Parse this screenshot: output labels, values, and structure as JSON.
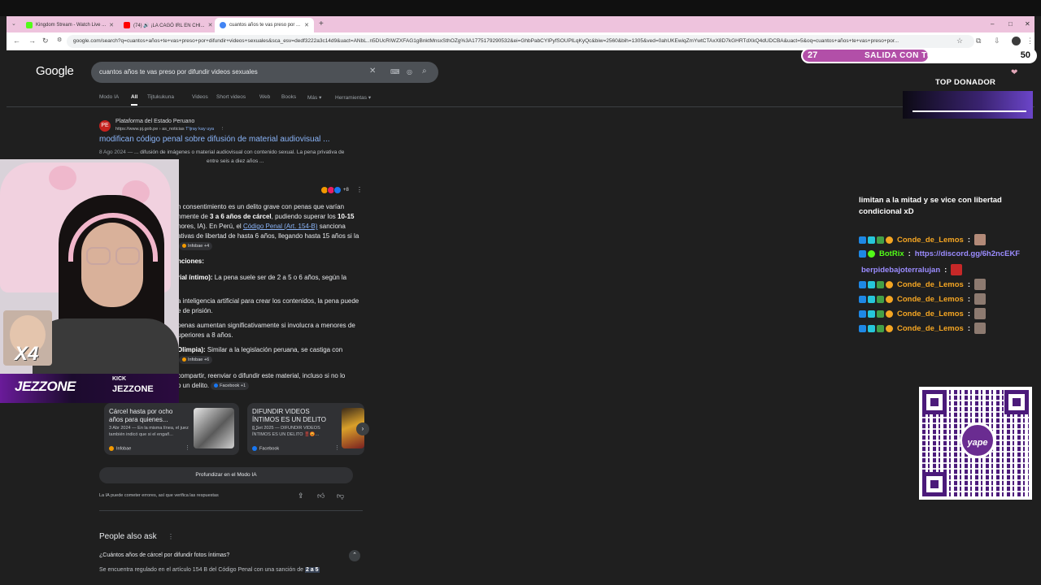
{
  "browser": {
    "tabs": [
      {
        "label": "Kingdom Stream - Watch Live ...",
        "color": "#53fc18"
      },
      {
        "label": "(74) 🔊 ¡LA CAGÓ IRL EN CHI...",
        "color": "#ff0000"
      },
      {
        "label": "cuantos años te vas preso por ...",
        "color": "#4285f4"
      }
    ],
    "new_tab": "+",
    "window_controls": {
      "minimize": "–",
      "maximize": "□",
      "close": "✕"
    },
    "url": "google.com/search?q=cuantos+años+te+vas+preso+por+difundir+videos+sexuales&sca_esv=dedf3222a3c14d9&uact=ANbL..n5DUcRIWZXFAG1gBnktMnsxSthOZg%3A1775179290532&ei=GhbPabCYIPyfSOUPlLqKyQc&biw=2560&bih=1305&ved=0ahUKEwiqZmYwtCTAxX8D7kGHRTdXkQ4dUDCBA&uact=5&oq=cuantos+años+te+vas+preso+por..."
  },
  "google": {
    "logo": "Google",
    "query": "cuantos años te vas preso por difundir videos sexuales",
    "tabs": [
      "Modo IA",
      "All",
      "Tijtukukuna",
      "Videos",
      "Short videos",
      "Web",
      "Books",
      "Más ▾",
      "Herramientas ▾"
    ],
    "result": {
      "favicon": "PE",
      "site": "Plataforma del Estado Peruano",
      "url": "https://www.pj.gob.pe › as_noticias",
      "translate": "T'ijray kay uyа",
      "menu": "⋮",
      "title": "modifican código penal sobre difusión de material audiovisual ...",
      "date": "8 Ago 2024 —",
      "snippet": " ... difusión de imágenes o material audiovisual con contenido sexual. La pena privativa de",
      "snippet2": "entre seis a diez años ..."
    },
    "ai": {
      "heading": "IA",
      "sources_more": "+8",
      "lines": [
        {
          "pre": "n consentimiento es un delito grave con penas que varían",
          "bold": "",
          "post": ""
        },
        {
          "pre": "nmente de ",
          "bold": "3 a 6 años de cárcel",
          "post": ", pudiendo superar los ",
          "bold2": "10-15"
        },
        {
          "pre": "nores, IA). En Perú, el ",
          "link": "Código Penal (Art. 154-B)",
          "post": " sanciona"
        },
        {
          "pre": "ativas de libertad de hasta 6 años, llegando hasta 15 años si la",
          "bold": "",
          "post": ""
        }
      ],
      "chip1": "Infobae +4",
      "subheading": "nciones:",
      "items": [
        {
          "bold": "rial íntimo):",
          "text": " La pena suele ser de 2 a 5 o 6 años, según la"
        },
        {
          "bold": "",
          "text": "a inteligencia artificial para crear los contenidos, la pena puede"
        },
        {
          "bold": "",
          "text": "e de prisión."
        },
        {
          "bold": "",
          "text": "penas aumentan significativamente si involucra a menores de"
        },
        {
          "bold": "",
          "text": "uperiores a 8 años."
        },
        {
          "bold": "Olimpia):",
          "text": " Similar a la legislación peruana, se castiga con"
        },
        {
          "bold": "",
          "text": "compartir, reenviar o difundir este material, incluso si no lo"
        },
        {
          "bold": "",
          "text": "o un delito."
        }
      ],
      "chip2": "Infobae +6",
      "chip3": "Facebook +1"
    },
    "cards": [
      {
        "title": "Cárcel hasta por ocho años para quienes...",
        "snippet": "3 Abr 2024 — En la misma línea, el juez también indicó que si el engañ...",
        "source": "Infobae"
      },
      {
        "title": "DIFUNDIR VIDEOS ÍNTIMOS ES UN DELITO ...",
        "snippet": "8 Set 2025 — DIFUNDIR VIDEOS ÍNTIMOS ES UN DELITO ‼️😡...",
        "source": "Facebook"
      }
    ],
    "deep_button": "Profundizar en el Modo IA",
    "disclaimer": "La IA puede cometer errores, así que verifica las respuestas",
    "paa_title": "People also ask",
    "paa_question": "¿Cuántos años de cárcel por difundir fotos íntimas?",
    "paa_answer": "Se encuentra regulado en el artículo 154 B del Código Penal con una sanción de ",
    "paa_answer_hl": "2 a 5"
  },
  "overlay": {
    "multiplier": "X4",
    "brand": "JEZZONE",
    "kick_label": "KICK",
    "kick_name": "JEZZONE",
    "goal": {
      "current": "27",
      "label": "SALIDA CON TU VIEJO",
      "max": "50",
      "fraction": 0.54
    },
    "top_donor_label": "TOP DONADOR",
    "chat_partial": [
      "limitan a la mitad y se vice con libertad",
      "condicional xD"
    ],
    "chat": [
      {
        "user": "Conde_de_Lemos",
        "color": "#f5a623",
        "text": ""
      },
      {
        "user": "BotRix",
        "color": "#53fc18",
        "text": "https://discord.gg/6h2ncEKF"
      },
      {
        "user": "berpidebajoterralujan",
        "color": "#9b8cff",
        "text": ""
      },
      {
        "user": "Conde_de_Lemos",
        "color": "#f5a623",
        "text": ""
      },
      {
        "user": "Conde_de_Lemos",
        "color": "#f5a623",
        "text": ""
      },
      {
        "user": "Conde_de_Lemos",
        "color": "#f5a623",
        "text": ""
      },
      {
        "user": "Conde_de_Lemos",
        "color": "#f5a623",
        "text": ""
      }
    ],
    "qr_logo": "yape"
  }
}
